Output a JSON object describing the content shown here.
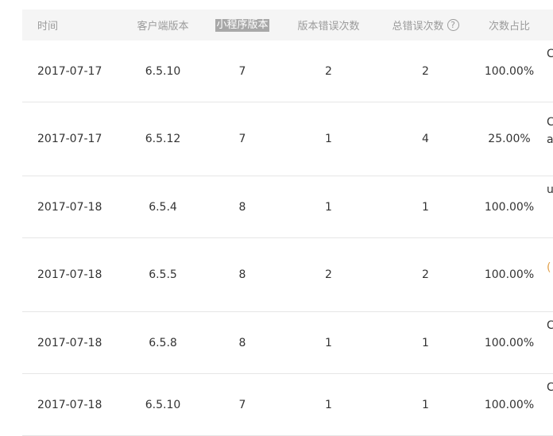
{
  "table": {
    "headers": {
      "time": "时间",
      "client_version": "客户端版本",
      "mini_version": "小程序版本",
      "version_errors": "版本错误次数",
      "total_errors": "总错误次数",
      "ratio": "次数占比"
    },
    "help_icon": "question-circle-icon",
    "rows": [
      {
        "time": "2017-07-17",
        "client": "6.5.10",
        "mini": "7",
        "verr": "2",
        "terr": "2",
        "ratio": "100.00%",
        "extra1": "C",
        "extra2": ""
      },
      {
        "time": "2017-07-17",
        "client": "6.5.12",
        "mini": "7",
        "verr": "1",
        "terr": "4",
        "ratio": "25.00%",
        "extra1": "C",
        "extra2": "a"
      },
      {
        "time": "2017-07-18",
        "client": "6.5.4",
        "mini": "8",
        "verr": "1",
        "terr": "1",
        "ratio": "100.00%",
        "extra1": "u",
        "extra2": ""
      },
      {
        "time": "2017-07-18",
        "client": "6.5.5",
        "mini": "8",
        "verr": "2",
        "terr": "2",
        "ratio": "100.00%",
        "extra1": "",
        "extra2": "("
      },
      {
        "time": "2017-07-18",
        "client": "6.5.8",
        "mini": "8",
        "verr": "1",
        "terr": "1",
        "ratio": "100.00%",
        "extra1": "C",
        "extra2": ""
      },
      {
        "time": "2017-07-18",
        "client": "6.5.10",
        "mini": "7",
        "verr": "1",
        "terr": "1",
        "ratio": "100.00%",
        "extra1": "C",
        "extra2": ""
      }
    ]
  }
}
